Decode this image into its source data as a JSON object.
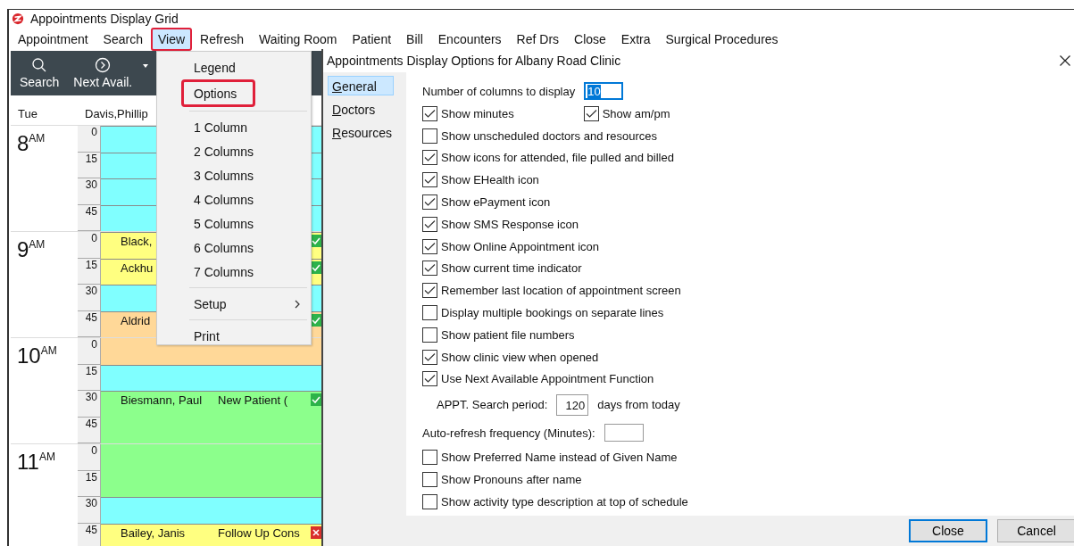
{
  "main_window": {
    "title": "Appointments Display Grid"
  },
  "menu_bar": [
    {
      "label": "Appointment",
      "selected": false,
      "annotated": false
    },
    {
      "label": "Search",
      "selected": false,
      "annotated": false
    },
    {
      "label": "View",
      "selected": true,
      "annotated": true
    },
    {
      "label": "Refresh",
      "selected": false,
      "annotated": false
    },
    {
      "label": "Waiting Room",
      "selected": false,
      "annotated": false
    },
    {
      "label": "Patient",
      "selected": false,
      "annotated": false
    },
    {
      "label": "Bill",
      "selected": false,
      "annotated": false
    },
    {
      "label": "Encounters",
      "selected": false,
      "annotated": false
    },
    {
      "label": "Ref Drs",
      "selected": false,
      "annotated": false
    },
    {
      "label": "Close",
      "selected": false,
      "annotated": false
    },
    {
      "label": "Extra",
      "selected": false,
      "annotated": false
    },
    {
      "label": "Surgical Procedures",
      "selected": false,
      "annotated": false
    }
  ],
  "toolbar": [
    {
      "kind": "search",
      "label": "Search"
    },
    {
      "kind": "next",
      "label": "Next Avail."
    }
  ],
  "schedule": {
    "day": "Tue",
    "doctor": "Davis,Phillip",
    "hours": [
      {
        "hour": "8",
        "suffix": "AM",
        "slots": [
          {
            "minute": "0",
            "color": "#80ffff",
            "continued": false
          },
          {
            "minute": "15",
            "color": "#80ffff",
            "continued": false
          },
          {
            "minute": "30",
            "color": "#80ffff",
            "continued": false
          },
          {
            "minute": "45",
            "color": "#80ffff",
            "continued": false
          }
        ]
      },
      {
        "hour": "9",
        "suffix": "AM",
        "slots": [
          {
            "minute": "0",
            "color": "#ffff80",
            "continued": false,
            "patient": "Black,",
            "attended": true,
            "cancelled": false
          },
          {
            "minute": "15",
            "color": "#ffff80",
            "continued": false,
            "patient": "Ackhu",
            "attended": true,
            "cancelled": false
          },
          {
            "minute": "30",
            "color": "#80ffff",
            "continued": false
          },
          {
            "minute": "45",
            "color": "#ffd898",
            "continued": false,
            "patient": "Aldrid",
            "attended": true,
            "cancelled": false
          }
        ]
      },
      {
        "hour": "10",
        "suffix": "AM",
        "slots": [
          {
            "minute": "0",
            "color": "#ffd898",
            "continued": true
          },
          {
            "minute": "15",
            "color": "#80ffff",
            "continued": false
          },
          {
            "minute": "30",
            "color": "#8cff8c",
            "continued": false,
            "patient": "Biesmann, Paul",
            "type": "New Patient (",
            "attended": true,
            "cancelled": false
          },
          {
            "minute": "45",
            "color": "#8cff8c",
            "continued": true
          }
        ]
      },
      {
        "hour": "11",
        "suffix": "AM",
        "slots": [
          {
            "minute": "0",
            "color": "#8cff8c",
            "continued": true
          },
          {
            "minute": "15",
            "color": "#8cff8c",
            "continued": true
          },
          {
            "minute": "30",
            "color": "#80ffff",
            "continued": false
          },
          {
            "minute": "45",
            "color": "#ffff80",
            "continued": false,
            "patient": "Bailey, Janis",
            "type": "Follow Up Cons",
            "attended": false,
            "cancelled": true
          }
        ]
      }
    ]
  },
  "view_menu": [
    {
      "kind": "item",
      "label": "Legend",
      "annotated": false
    },
    {
      "kind": "item",
      "label": "Options",
      "annotated": true
    },
    {
      "kind": "separator"
    },
    {
      "kind": "item",
      "label": "1 Column",
      "annotated": false
    },
    {
      "kind": "item",
      "label": "2 Columns",
      "annotated": false
    },
    {
      "kind": "item",
      "label": "3 Columns",
      "annotated": false
    },
    {
      "kind": "item",
      "label": "4 Columns",
      "annotated": false
    },
    {
      "kind": "item",
      "label": "5 Columns",
      "annotated": false
    },
    {
      "kind": "item",
      "label": "6 Columns",
      "annotated": false
    },
    {
      "kind": "item",
      "label": "7 Columns",
      "annotated": false
    },
    {
      "kind": "separator"
    },
    {
      "kind": "submenu",
      "label": "Setup",
      "annotated": false
    },
    {
      "kind": "separator"
    },
    {
      "kind": "item",
      "label": "Print",
      "annotated": false
    }
  ],
  "dialog": {
    "title": "Appointments Display Options for Albany Road Clinic",
    "nav": [
      {
        "label": "General",
        "selected": true
      },
      {
        "label": "Doctors",
        "selected": false
      },
      {
        "label": "Resources",
        "selected": false
      }
    ],
    "rows": [
      {
        "kind": "field",
        "label": "Number of columns to display",
        "value": "10",
        "highlighted": true
      },
      {
        "kind": "checks",
        "items": [
          {
            "label": "Show minutes",
            "checked": true
          },
          {
            "label": "Show am/pm",
            "checked": true
          }
        ]
      },
      {
        "kind": "check",
        "label": "Show unscheduled doctors and resources",
        "checked": false
      },
      {
        "kind": "check",
        "label": "Show icons for attended, file pulled and billed",
        "checked": true
      },
      {
        "kind": "check",
        "label": "Show EHealth icon",
        "checked": true
      },
      {
        "kind": "check",
        "label": "Show ePayment icon",
        "checked": true
      },
      {
        "kind": "check",
        "label": "Show SMS Response icon",
        "checked": true
      },
      {
        "kind": "check",
        "label": "Show Online Appointment icon",
        "checked": true
      },
      {
        "kind": "check",
        "label": "Show current time indicator",
        "checked": true
      },
      {
        "kind": "check",
        "label": "Remember last location of appointment screen",
        "checked": true
      },
      {
        "kind": "check",
        "label": "Display multiple bookings on separate lines",
        "checked": false
      },
      {
        "kind": "check",
        "label": "Show patient file numbers",
        "checked": false
      },
      {
        "kind": "check",
        "label": "Show clinic view when opened",
        "checked": true
      },
      {
        "kind": "check",
        "label": "Use Next Available Appointment Function",
        "checked": true
      },
      {
        "kind": "period",
        "label": "APPT. Search period:",
        "value": "120",
        "suffix": "days from today"
      },
      {
        "kind": "field",
        "label": "Auto-refresh frequency (Minutes):",
        "highlighted": false
      },
      {
        "kind": "check",
        "label": "Show Preferred Name instead of Given Name",
        "checked": false
      },
      {
        "kind": "check",
        "label": "Show Pronouns after name",
        "checked": false
      },
      {
        "kind": "check",
        "label": "Show activity type description at top of schedule",
        "checked": false
      }
    ],
    "buttons": [
      {
        "label": "Close",
        "default": true
      },
      {
        "label": "Cancel",
        "default": false
      }
    ]
  }
}
